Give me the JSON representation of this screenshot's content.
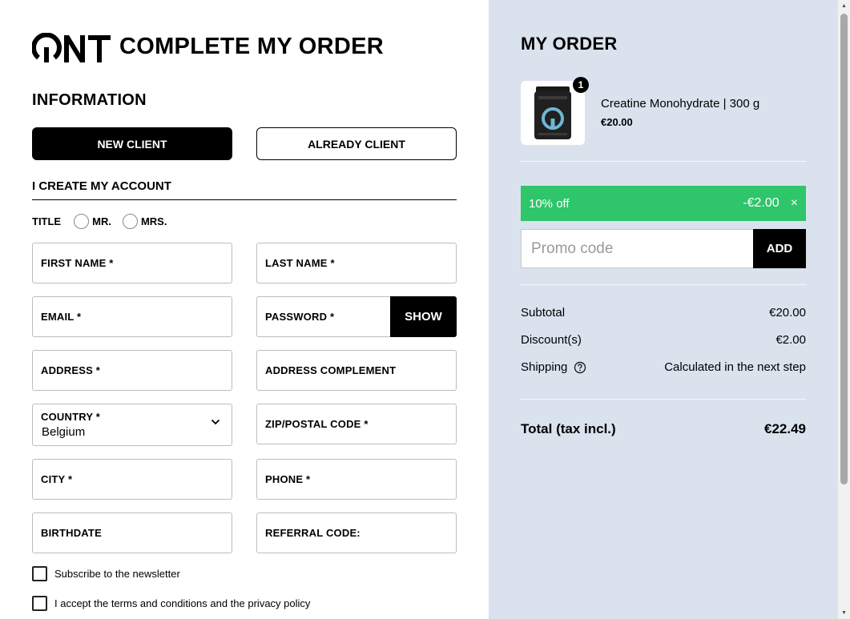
{
  "header": {
    "logo_text": "QNT",
    "title": "COMPLETE MY ORDER"
  },
  "information": {
    "title": "INFORMATION",
    "new_client_label": "NEW CLIENT",
    "already_client_label": "ALREADY CLIENT",
    "create_account_title": "I CREATE MY ACCOUNT",
    "title_label": "TITLE",
    "title_options": [
      "MR.",
      "MRS."
    ]
  },
  "form": {
    "first_name": "FIRST NAME *",
    "last_name": "LAST NAME *",
    "email": "EMAIL *",
    "password": "PASSWORD *",
    "show_label": "SHOW",
    "address": "ADDRESS *",
    "address_complement": "ADDRESS COMPLEMENT",
    "country_label": "COUNTRY *",
    "country_value": "Belgium",
    "zip": "ZIP/POSTAL CODE *",
    "city": "CITY *",
    "phone": "PHONE *",
    "birthdate": "BIRTHDATE",
    "referral": "REFERRAL CODE:",
    "newsletter_label": "Subscribe to the newsletter",
    "terms_label": "I accept the terms and conditions and the privacy policy"
  },
  "order": {
    "title": "MY ORDER",
    "item": {
      "quantity": "1",
      "name": "Creatine Monohydrate | 300 g",
      "price": "€20.00"
    },
    "discount": {
      "label": "10% off",
      "amount": "-€2.00",
      "remove": "×"
    },
    "promo_placeholder": "Promo code",
    "add_label": "ADD",
    "subtotal_label": "Subtotal",
    "subtotal_value": "€20.00",
    "discounts_label": "Discount(s)",
    "discounts_value": "€2.00",
    "shipping_label": "Shipping",
    "shipping_value": "Calculated in the next step",
    "total_label": "Total (tax incl.)",
    "total_value": "€22.49"
  },
  "colors": {
    "discount_green": "#2ec56b",
    "summary_bg": "#dae2ee",
    "primary_black": "#000000"
  }
}
